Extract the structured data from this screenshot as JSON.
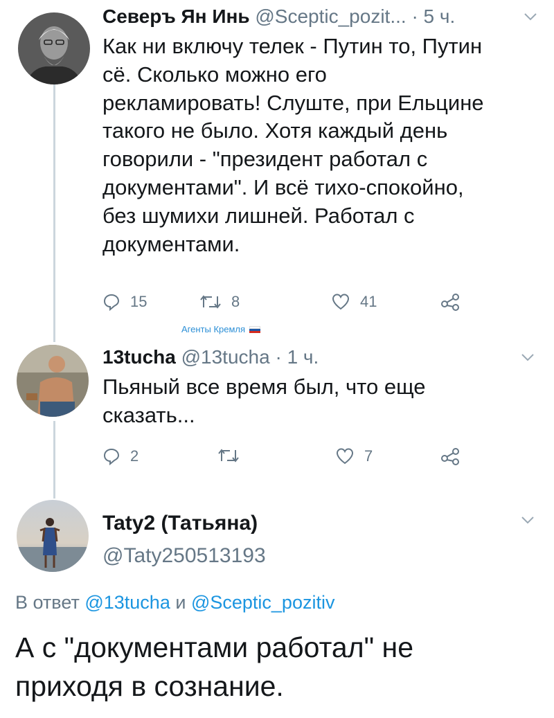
{
  "tweet1": {
    "name": "Северъ Ян Инь",
    "handle": "@Sceptic_pozit...",
    "time": "· 5 ч.",
    "lines": [
      "Как ни включу телек - Путин то, Путин",
      "сё. Сколько можно его",
      "рекламировать! Слуште, при Ельцине",
      "такого не было. Хотя каждый день",
      "говорили - \"президент работал с",
      "документами\". И всё тихо-спокойно,",
      "без шумихи лишней. Работал с",
      "документами."
    ],
    "replies": "15",
    "retweets": "8",
    "likes": "41",
    "icons": [
      "reply-icon",
      "retweet-icon",
      "like-icon",
      "share-icon",
      "chevron-down-icon"
    ]
  },
  "watermark": {
    "text": "Агенты Кремля",
    "flag_colors": [
      "#ffffff",
      "#1c57a5",
      "#d52b1e"
    ]
  },
  "tweet2": {
    "name": "13tucha",
    "handle": "@13tucha",
    "time": "· 1 ч.",
    "lines": [
      "Пьяный все время был, что еще",
      "сказать..."
    ],
    "replies": "2",
    "likes": "7"
  },
  "tweet3": {
    "name": "Taty2 (Татьяна)",
    "handle": "@Taty250513193",
    "reply_prefix": "В ответ",
    "reply_mention1": "@13tucha",
    "reply_and": "и",
    "reply_mention2": "@Sceptic_pozitiv",
    "lines": [
      "А с \"документами работал\" не",
      "приходя в сознание."
    ]
  },
  "colors": {
    "text": "#14171a",
    "secondary": "#657786",
    "link": "#1b95e0",
    "thread_line": "#ccd6dd"
  }
}
